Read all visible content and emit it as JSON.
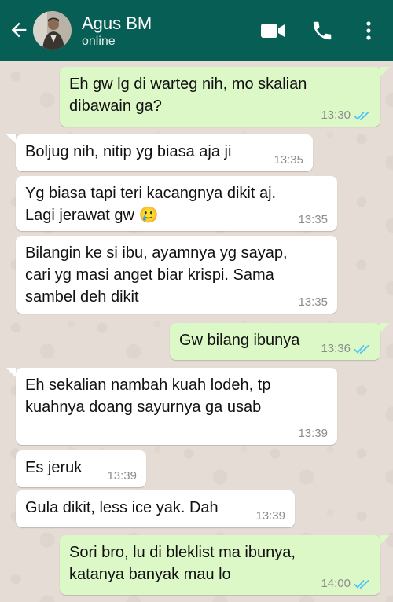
{
  "header": {
    "contact_name": "Agus BM",
    "status": "online",
    "icons": [
      "back-arrow-icon",
      "avatar",
      "video-call-icon",
      "phone-icon",
      "more-vert-icon"
    ]
  },
  "colors": {
    "header": "#075e54",
    "outgoing_bubble": "#dcf8c6",
    "incoming_bubble": "#ffffff",
    "read_ticks": "#4fc3f7"
  },
  "messages": [
    {
      "direction": "out",
      "text": "Eh gw lg di warteg nih, mo skalian dibawain ga?",
      "time": "13:30",
      "read": true
    },
    {
      "direction": "in",
      "text": "Boljug nih, nitip yg biasa aja ji",
      "time": "13:35"
    },
    {
      "direction": "in",
      "text": "Yg biasa tapi teri kacangnya dikit aj. Lagi jerawat gw 🥲",
      "time": "13:35"
    },
    {
      "direction": "in",
      "text": "Bilangin ke si ibu, ayamnya yg sayap, cari yg masi anget biar krispi. Sama sambel deh dikit",
      "time": "13:35"
    },
    {
      "direction": "out",
      "text": "Gw bilang ibunya",
      "time": "13:36",
      "read": true
    },
    {
      "direction": "in",
      "text": "Eh sekalian nambah kuah lodeh, tp kuahnya doang sayurnya ga usab",
      "time": "13:39"
    },
    {
      "direction": "in",
      "text": "Es jeruk",
      "time": "13:39"
    },
    {
      "direction": "in",
      "text": "Gula dikit, less ice yak. Dah",
      "time": "13:39"
    },
    {
      "direction": "out",
      "text": "Sori bro, lu di bleklist ma ibunya, katanya banyak mau lo",
      "time": "14:00",
      "read": true
    }
  ]
}
